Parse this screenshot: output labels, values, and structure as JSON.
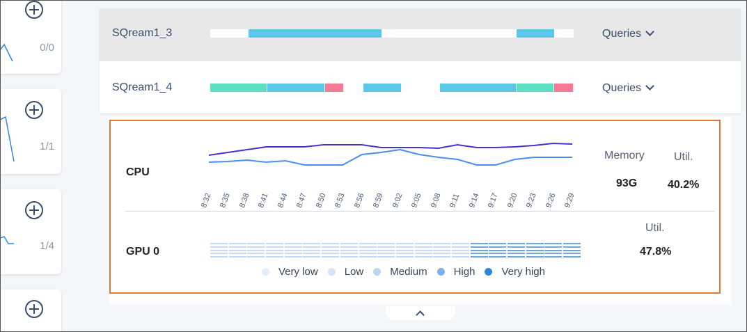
{
  "left_cards": [
    {
      "count": "0/0"
    },
    {
      "count": "1/1"
    },
    {
      "count": "1/4"
    },
    {
      "count": ""
    }
  ],
  "workers": [
    {
      "name": "SQream1_3",
      "queries_label": "Queries",
      "segments": [
        {
          "color": "#ffffff",
          "w": 2
        },
        {
          "color": "#5bc8ea",
          "w": 7
        },
        {
          "color": "#ffffff",
          "w": 7
        },
        {
          "color": "#5bc8ea",
          "w": 2
        },
        {
          "color": "#ffffff",
          "w": 1
        }
      ]
    },
    {
      "name": "SQream1_4",
      "queries_label": "Queries",
      "segments": [
        {
          "color": "#5de0c2",
          "w": 3
        },
        {
          "color": "#5bc8ea",
          "w": 3
        },
        {
          "color": "#f47a95",
          "w": 1
        },
        {
          "color": "#ffffff",
          "w": 1
        },
        {
          "color": "#5bc8ea",
          "w": 2
        },
        {
          "color": "#ffffff",
          "w": 2
        },
        {
          "color": "#5bc8ea",
          "w": 4
        },
        {
          "color": "#5de0c2",
          "w": 2
        },
        {
          "color": "#f47a95",
          "w": 1
        }
      ]
    }
  ],
  "cpu": {
    "label": "CPU",
    "memory_label": "Memory",
    "memory_value": "93G",
    "util_label": "Util.",
    "util_value": "40.2%",
    "times": [
      "8:32",
      "8:35",
      "8:38",
      "8:41",
      "8:44",
      "8:47",
      "8:50",
      "8:53",
      "8:56",
      "8:59",
      "9:02",
      "9:05",
      "9:08",
      "9:11",
      "9:14",
      "9:17",
      "9:20",
      "9:23",
      "9:26",
      "9:29"
    ],
    "chart_data": {
      "type": "line",
      "x": [
        "8:32",
        "8:35",
        "8:38",
        "8:41",
        "8:44",
        "8:47",
        "8:50",
        "8:53",
        "8:56",
        "8:59",
        "9:02",
        "9:05",
        "9:08",
        "9:11",
        "9:14",
        "9:17",
        "9:20",
        "9:23",
        "9:26",
        "9:29"
      ],
      "series": [
        {
          "color": "#4a2fd0",
          "values": [
            18,
            14,
            10,
            6,
            6,
            6,
            3,
            3,
            3,
            7,
            7,
            7,
            8,
            3,
            7,
            7,
            6,
            4,
            1,
            2
          ]
        },
        {
          "color": "#4a8df0",
          "values": [
            28,
            27,
            25,
            28,
            26,
            32,
            32,
            32,
            17,
            14,
            10,
            17,
            21,
            24,
            32,
            32,
            24,
            21,
            21,
            21
          ]
        }
      ],
      "ylim": [
        0,
        40
      ]
    }
  },
  "gpu": {
    "label": "GPU 0",
    "util_label": "Util.",
    "util_value": "47.8%",
    "levels": [
      2,
      2,
      2,
      2,
      2,
      2,
      2,
      2,
      2,
      2,
      2,
      2,
      2,
      2,
      4,
      4,
      4,
      4,
      4,
      4
    ]
  },
  "legend": [
    {
      "label": "Very low",
      "color": "#e4ecf8"
    },
    {
      "label": "Low",
      "color": "#d5e3f6"
    },
    {
      "label": "Medium",
      "color": "#bcd6f2"
    },
    {
      "label": "High",
      "color": "#7fb0ea"
    },
    {
      "label": "Very high",
      "color": "#2f86dd"
    }
  ],
  "level_colors": {
    "2": "#c6dbf3",
    "4": "#6ea6e6"
  }
}
